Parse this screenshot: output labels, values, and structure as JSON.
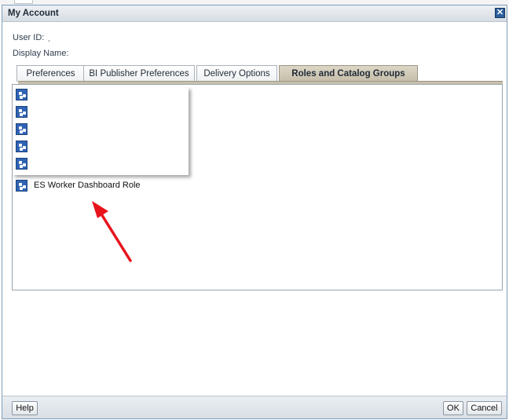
{
  "dialog": {
    "title": "My Account",
    "close_icon": "close-icon"
  },
  "fields": {
    "user_id_label": "User ID:",
    "user_id_value": "ˏ",
    "display_name_label": "Display Name:",
    "display_name_value": ""
  },
  "tabs": [
    {
      "label": "Preferences",
      "active": false
    },
    {
      "label": "BI Publisher Preferences",
      "active": false
    },
    {
      "label": "Delivery Options",
      "active": false
    },
    {
      "label": "Roles and Catalog Groups",
      "active": true
    }
  ],
  "roles": {
    "icon": "role-icon",
    "items": [
      {
        "label": ""
      },
      {
        "label": ""
      },
      {
        "label": ""
      },
      {
        "label": ""
      },
      {
        "label": ""
      },
      {
        "label": "ES Worker Dashboard Role"
      }
    ]
  },
  "annotation": {
    "color": "#e8141c",
    "icon": "red-arrow-annotation"
  },
  "footer": {
    "help_label": "Help",
    "ok_label": "OK",
    "cancel_label": "Cancel"
  }
}
